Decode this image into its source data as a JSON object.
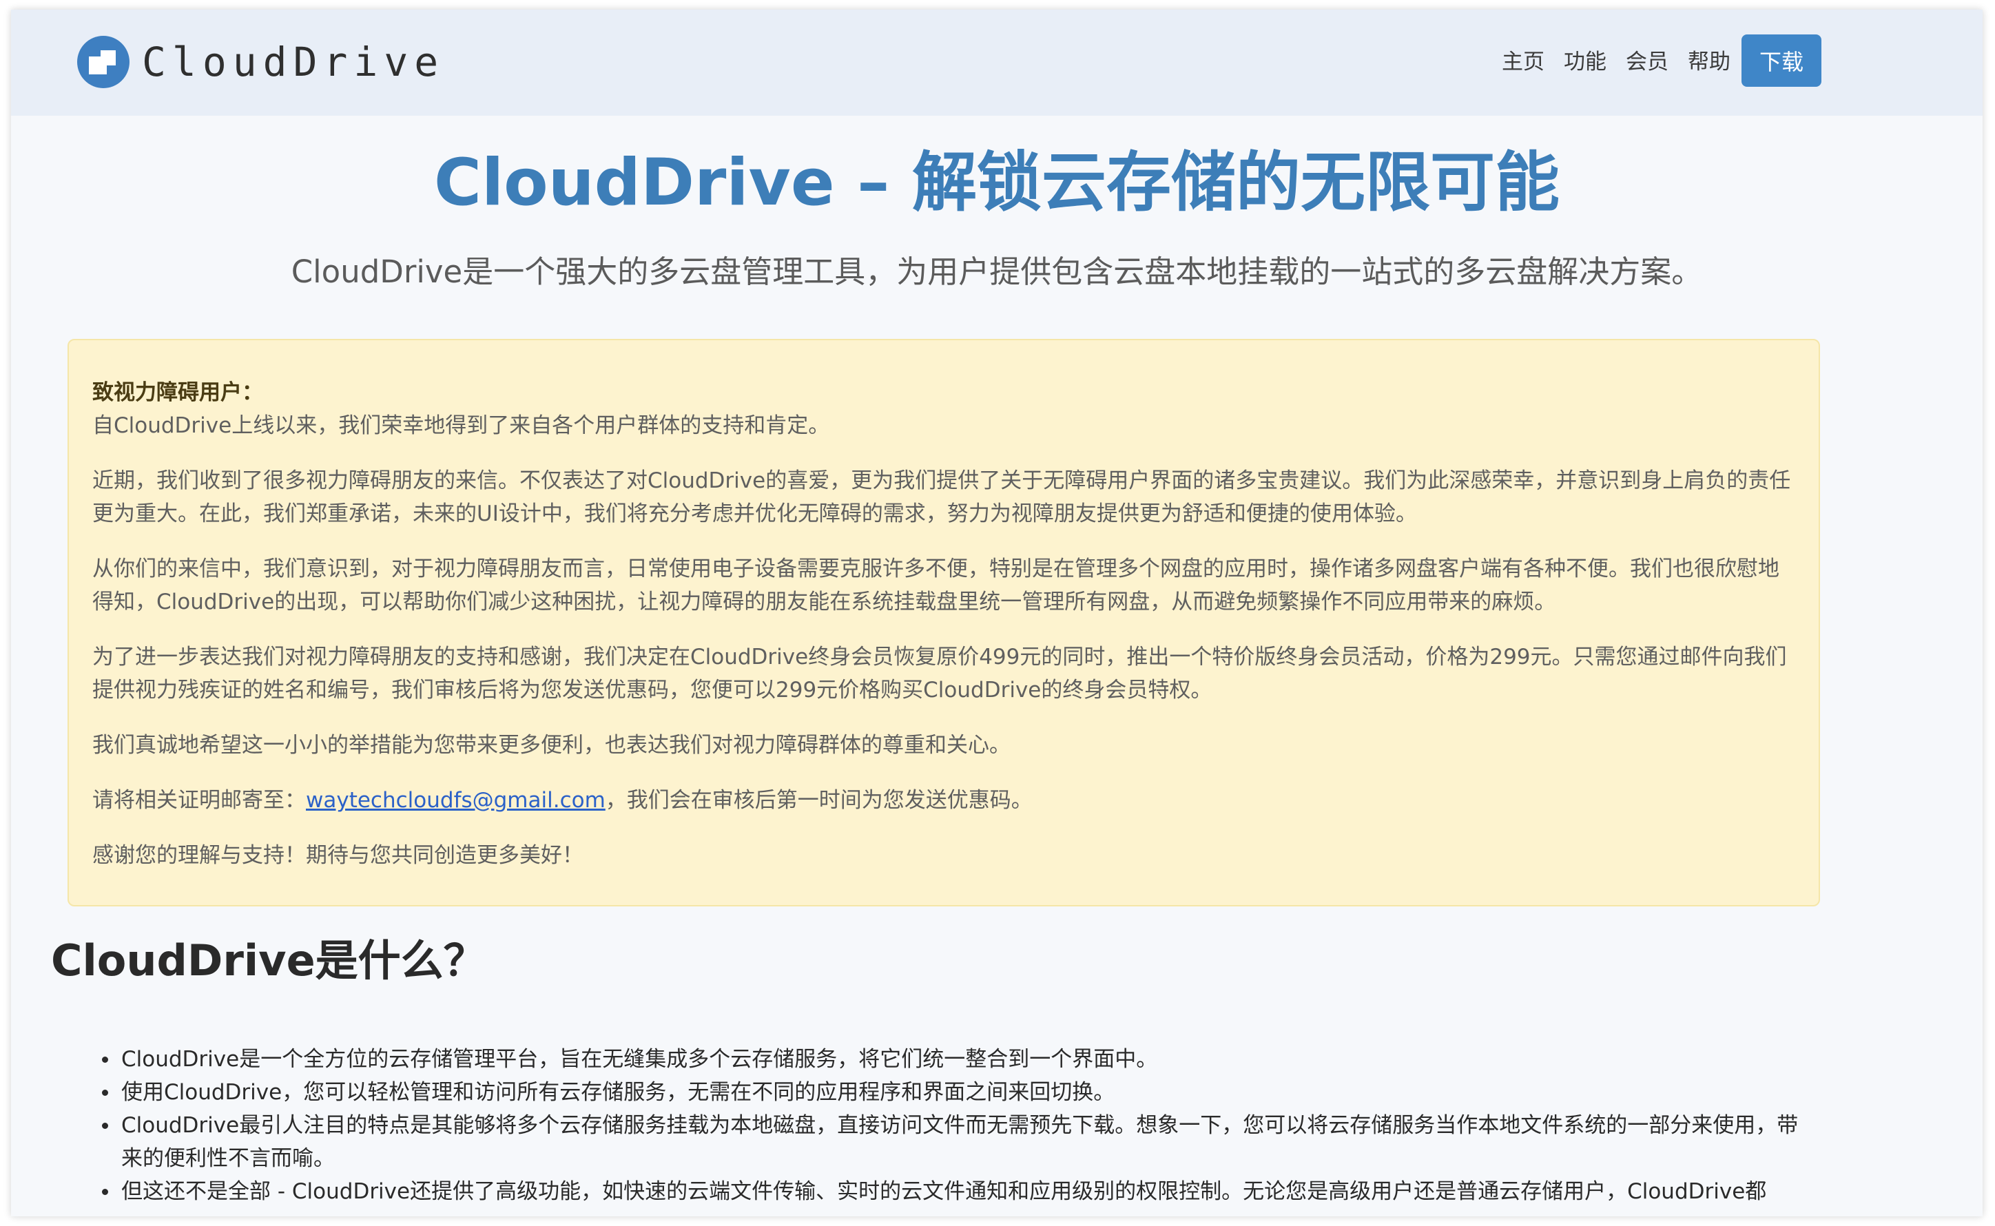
{
  "header": {
    "logo_text": "CloudDrive",
    "nav": [
      "主页",
      "功能",
      "会员",
      "帮助"
    ],
    "download_label": "下载"
  },
  "hero": {
    "title": "CloudDrive – 解锁云存储的无限可能",
    "subtitle": "CloudDrive是一个强大的多云盘管理工具，为用户提供包含云盘本地挂载的一站式的多云盘解决方案。"
  },
  "notice": {
    "heading": "致视力障碍用户：",
    "line1": "自CloudDrive上线以来，我们荣幸地得到了来自各个用户群体的支持和肯定。",
    "p1": "近期，我们收到了很多视力障碍朋友的来信。不仅表达了对CloudDrive的喜爱，更为我们提供了关于无障碍用户界面的诸多宝贵建议。我们为此深感荣幸，并意识到身上肩负的责任更为重大。在此，我们郑重承诺，未来的UI设计中，我们将充分考虑并优化无障碍的需求，努力为视障朋友提供更为舒适和便捷的使用体验。",
    "p2": "从你们的来信中，我们意识到，对于视力障碍朋友而言，日常使用电子设备需要克服许多不便，特别是在管理多个网盘的应用时，操作诸多网盘客户端有各种不便。我们也很欣慰地得知，CloudDrive的出现，可以帮助你们减少这种困扰，让视力障碍的朋友能在系统挂载盘里统一管理所有网盘，从而避免频繁操作不同应用带来的麻烦。",
    "p3": "为了进一步表达我们对视力障碍朋友的支持和感谢，我们决定在CloudDrive终身会员恢复原价499元的同时，推出一个特价版终身会员活动，价格为299元。只需您通过邮件向我们提供视力残疾证的姓名和编号，我们审核后将为您发送优惠码，您便可以299元价格购买CloudDrive的终身会员特权。",
    "p4": "我们真诚地希望这一小小的举措能为您带来更多便利，也表达我们对视力障碍群体的尊重和关心。",
    "p5_prefix": "请将相关证明邮寄至：",
    "email": "waytechcloudfs@gmail.com",
    "p5_suffix": "，我们会在审核后第一时间为您发送优惠码。",
    "p6": "感谢您的理解与支持！期待与您共同创造更多美好！"
  },
  "section": {
    "title": "CloudDrive是什么？",
    "items": [
      "CloudDrive是一个全方位的云存储管理平台，旨在无缝集成多个云存储服务，将它们统一整合到一个界面中。",
      "使用CloudDrive，您可以轻松管理和访问所有云存储服务，无需在不同的应用程序和界面之间来回切换。",
      "CloudDrive最引人注目的特点是其能够将多个云存储服务挂载为本地磁盘，直接访问文件而无需预先下载。想象一下，您可以将云存储服务当作本地文件系统的一部分来使用，带来的便利性不言而喻。",
      "但这还不是全部 - CloudDrive还提供了高级功能，如快速的云端文件传输、实时的云文件通知和应用级别的权限控制。无论您是高级用户还是普通云存储用户，CloudDrive都"
    ]
  }
}
